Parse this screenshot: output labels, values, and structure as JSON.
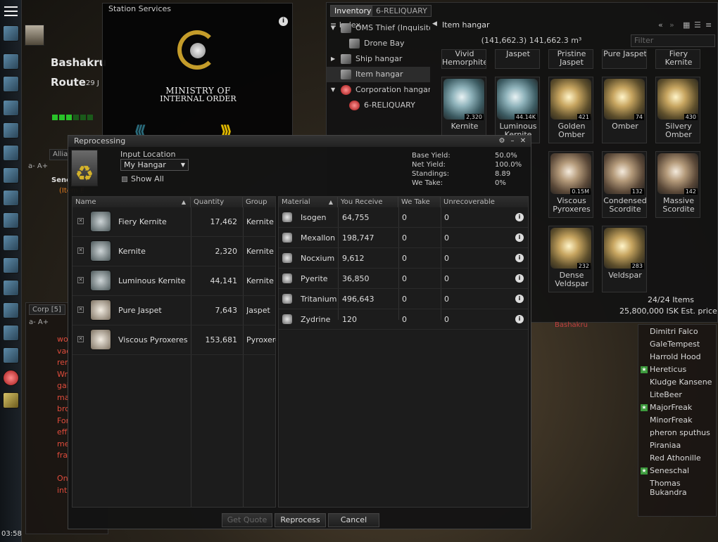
{
  "clock": "03:58",
  "background": {
    "char_name": "Bashakru",
    "route_label": "Route",
    "route_date": "29 J",
    "alliance_tab": "Alliance",
    "char_short": "Seneschal",
    "item_hint": "(Item E",
    "corp_tab": "Corp [5]",
    "font_ctl": "a- A+",
    "corp_lines": [
      "wo",
      "vac",
      "ren",
      "Wr",
      "gai",
      "ma",
      "bro",
      "For",
      "eff",
      "me",
      "fra",
      "",
      "On",
      "int"
    ],
    "bashakru_red": "Bashakru"
  },
  "station": {
    "title": "Station Services",
    "ministry_line1": "MINISTRY OF",
    "ministry_line2": "INTERNAL ORDER"
  },
  "inventory": {
    "tabs": [
      "Inventory",
      "6-RELIQUARY"
    ],
    "index_label": "Index",
    "tree": [
      {
        "label": "OMS Thief (Inquisito",
        "indent": 20,
        "tri": "▼",
        "icon": "ship-icon"
      },
      {
        "label": "Drone Bay",
        "indent": 32,
        "tri": "",
        "icon": "drone-bay-icon"
      },
      {
        "label": "Ship hangar",
        "indent": 20,
        "tri": "▶",
        "icon": "ship-hangar-icon"
      },
      {
        "label": "Item hangar",
        "indent": 20,
        "tri": "",
        "icon": "item-hangar-icon"
      },
      {
        "label": "Corporation hangars",
        "indent": 20,
        "tri": "▼",
        "icon": "corp-hangar-icon"
      },
      {
        "label": "6-RELIQUARY",
        "indent": 32,
        "tri": "",
        "icon": "station-icon"
      }
    ],
    "hangar_title": "Item hangar",
    "volume": "(141,662.3) 141,662.3 m³",
    "filter_placeholder": "Filter",
    "top_row_items": [
      "Vivid Hemorphite",
      "Jaspet",
      "Pristine Jaspet",
      "Pure Jaspet",
      "Fiery Kernite"
    ],
    "items": [
      {
        "name": "Kernite",
        "qty": "2,320",
        "style": "crystal"
      },
      {
        "name": "Luminous Kernite",
        "qty": "44.14K",
        "style": "crystal"
      },
      {
        "name": "Golden Omber",
        "qty": "421",
        "style": "golden"
      },
      {
        "name": "Omber",
        "qty": "74",
        "style": "golden"
      },
      {
        "name": "Silvery Omber",
        "qty": "430",
        "style": "golden"
      },
      {
        "name": "Viscous Pyroxeres",
        "qty": "0.15M",
        "style": "brown"
      },
      {
        "name": "Condensed Scordite",
        "qty": "132",
        "style": "brown"
      },
      {
        "name": "Massive Scordite",
        "qty": "142",
        "style": "brown"
      },
      {
        "name": "Dense Veldspar",
        "qty": "232",
        "style": "golden"
      },
      {
        "name": "Veldspar",
        "qty": "283",
        "style": "golden"
      }
    ],
    "item_count": "24/24 Items",
    "est_price": "25,800,000 ISK Est. price"
  },
  "members": [
    {
      "name": "Dimitri Falco",
      "star": false
    },
    {
      "name": "GaleTempest",
      "star": false
    },
    {
      "name": "Harrold Hood",
      "star": false
    },
    {
      "name": "Hereticus",
      "star": true
    },
    {
      "name": "Kludge Kansene",
      "star": false
    },
    {
      "name": "LiteBeer",
      "star": false
    },
    {
      "name": "MajorFreak",
      "star": true
    },
    {
      "name": "MinorFreak",
      "star": false
    },
    {
      "name": "pheron sputhus",
      "star": false
    },
    {
      "name": "Piraniaa",
      "star": false
    },
    {
      "name": "Red Athonille",
      "star": false
    },
    {
      "name": "Seneschal",
      "star": true
    },
    {
      "name": "Thomas Bukandra",
      "star": false
    }
  ],
  "repro": {
    "title": "Reprocessing",
    "input_location_label": "Input Location",
    "hangar_value": "My Hangar",
    "show_all": "Show All",
    "yields": [
      {
        "label": "Base Yield:",
        "value": "50.0%"
      },
      {
        "label": "Net Yield:",
        "value": "100.0%"
      },
      {
        "label": "Standings:",
        "value": "8.89"
      },
      {
        "label": "We Take:",
        "value": "0%"
      }
    ],
    "left_cols": [
      "Name",
      "Quantity",
      "Group"
    ],
    "right_cols": [
      "Material",
      "You Receive",
      "We Take",
      "Unrecoverable"
    ],
    "ores": [
      {
        "name": "Fiery Kernite",
        "qty": "17,462",
        "group": "Kernite"
      },
      {
        "name": "Kernite",
        "qty": "2,320",
        "group": "Kernite"
      },
      {
        "name": "Luminous Kernite",
        "qty": "44,141",
        "group": "Kernite"
      },
      {
        "name": "Pure Jaspet",
        "qty": "7,643",
        "group": "Jaspet"
      },
      {
        "name": "Viscous Pyroxeres",
        "qty": "153,681",
        "group": "Pyroxeres"
      }
    ],
    "materials": [
      {
        "name": "Isogen",
        "receive": "64,755",
        "take": "0",
        "unrec": "0"
      },
      {
        "name": "Mexallon",
        "receive": "198,747",
        "take": "0",
        "unrec": "0"
      },
      {
        "name": "Nocxium",
        "receive": "9,612",
        "take": "0",
        "unrec": "0"
      },
      {
        "name": "Pyerite",
        "receive": "36,850",
        "take": "0",
        "unrec": "0"
      },
      {
        "name": "Tritanium",
        "receive": "496,643",
        "take": "0",
        "unrec": "0"
      },
      {
        "name": "Zydrine",
        "receive": "120",
        "take": "0",
        "unrec": "0"
      }
    ],
    "buttons": {
      "quote": "Get Quote",
      "reprocess": "Reprocess",
      "cancel": "Cancel"
    }
  }
}
